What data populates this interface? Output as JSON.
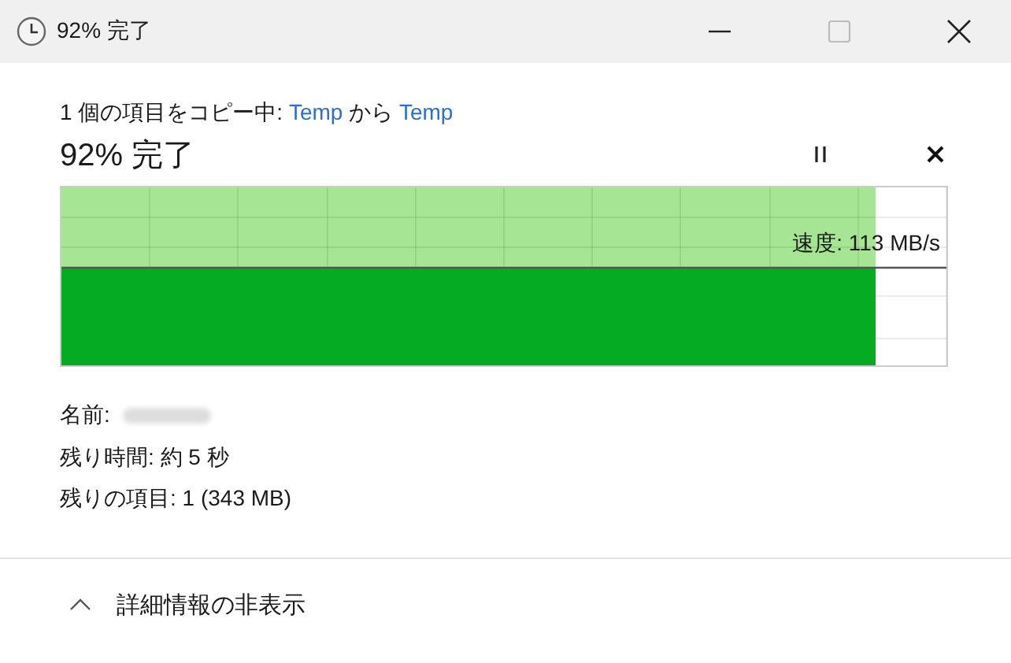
{
  "window": {
    "title": "92% 完了"
  },
  "copy_line": {
    "prefix": "1 個の項目をコピー中: ",
    "source": "Temp",
    "middle": " から ",
    "destination": "Temp"
  },
  "heading": "92% 完了",
  "progress": {
    "level": 0.92,
    "speed": "速度: 113 MB/s"
  },
  "details": [
    {
      "label": "名前:",
      "blurred": true
    },
    {
      "label": "残り時間: 約 5 秒",
      "blurred": false
    },
    {
      "label": "残りの項目: 1 (343 MB)",
      "blurred": false
    }
  ],
  "footer": {
    "label": "詳細情報の非表示",
    "expanded": true
  }
}
